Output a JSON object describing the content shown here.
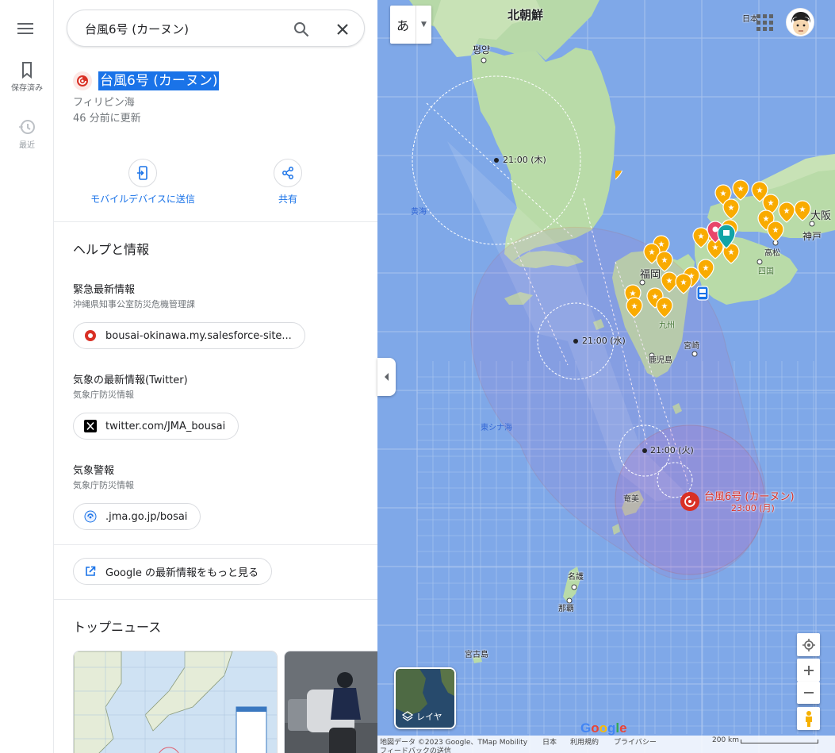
{
  "rail": {
    "saved_label": "保存済み",
    "recent_label": "最近"
  },
  "search": {
    "value": "台風6号 (カーヌン)"
  },
  "place": {
    "title": "台風6号 (カーヌン)",
    "region": "フィリピン海",
    "updated": "46 分前に更新"
  },
  "actions": {
    "send_label": "モバイルデバイスに送信",
    "share_label": "共有"
  },
  "help": {
    "title": "ヘルプと情報",
    "items": [
      {
        "title": "緊急最新情報",
        "source": "沖縄県知事公室防災危機管理課",
        "link": "bousai-okinawa.my.salesforce-site..."
      },
      {
        "title": "気象の最新情報(Twitter)",
        "source": "気象庁防災情報",
        "link": "twitter.com/JMA_bousai"
      },
      {
        "title": "気象警報",
        "source": "気象庁防災情報",
        "link": ".jma.go.jp/bosai"
      }
    ],
    "more_link": "Google の最新情報をもっと見る"
  },
  "news": {
    "title": "トップニュース"
  },
  "map": {
    "ime_label": "あ",
    "labels": {
      "north_korea": "北朝鮮",
      "pyongyang": "평양",
      "japan": "日本",
      "yellow_sea": "黄海",
      "east_china_sea": "東シナ海",
      "fukuoka": "福岡",
      "kyushu": "九州",
      "miyazaki": "宮崎",
      "kagoshima": "鹿児島",
      "osaka": "大阪",
      "kobe": "神戸",
      "takamatsu": "高松",
      "shikoku": "四国",
      "amami": "奄美",
      "nago": "名護",
      "naha": "那覇",
      "miyakojima": "宮古島"
    },
    "forecast": [
      {
        "time": "21:00 (木)"
      },
      {
        "time": "21:00 (水)"
      },
      {
        "time": "21:00 (火)"
      }
    ],
    "typhoon_name": "台風6号 (カーヌン)",
    "typhoon_time": "23:00 (月)",
    "layers_label": "レイヤ",
    "google_logo": "Google",
    "footer": {
      "attribution": "地図データ ©2023 Google、TMap Mobility",
      "country": "日本",
      "terms": "利用規約",
      "privacy": "プライバシー",
      "feedback": "フィードバックの送信",
      "scale": "200 km"
    }
  },
  "colors": {
    "accent": "#1a73e8",
    "typhoon_red": "#d93025",
    "sea": "#7fa8e8",
    "land": "#b7d9a8",
    "pin": "#f9ab00"
  }
}
